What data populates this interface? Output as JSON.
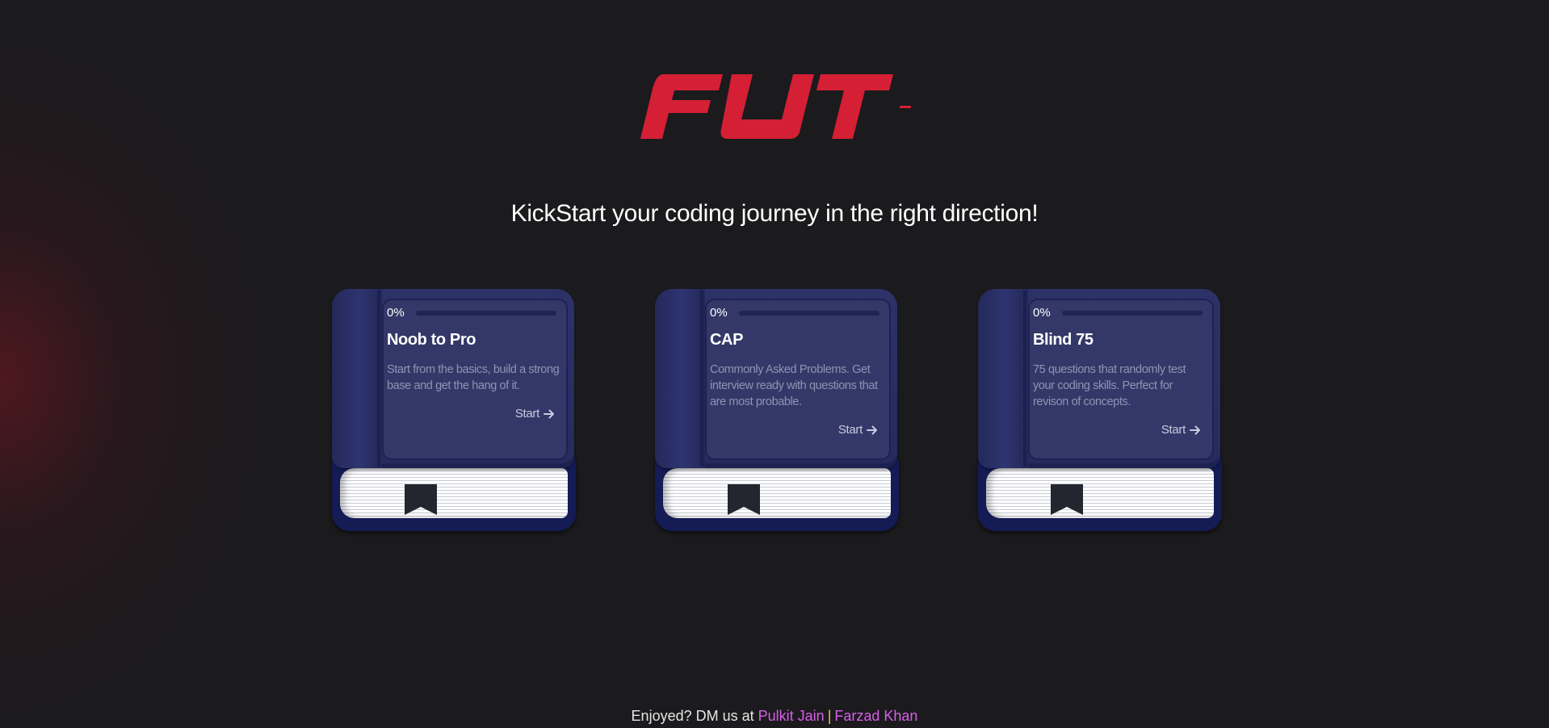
{
  "brand": {
    "logo_text": "FUT-",
    "accent_color": "#d41f35"
  },
  "hero": {
    "tagline": "KickStart your coding journey in the right direction!"
  },
  "books": [
    {
      "progress_label": "0%",
      "progress": 0,
      "title": "Noob to Pro",
      "description": "Start from the basics, build a strong base and get the hang of it.",
      "cta": "Start"
    },
    {
      "progress_label": "0%",
      "progress": 0,
      "title": "CAP",
      "description": "Commonly Asked Problems. Get interview ready with questions that are most probable.",
      "cta": "Start"
    },
    {
      "progress_label": "0%",
      "progress": 0,
      "title": "Blind 75",
      "description": "75 questions that randomly test your coding skills. Perfect for revison of concepts.",
      "cta": "Start"
    }
  ],
  "footer": {
    "prefix": "Enjoyed? DM us at",
    "separator": "|",
    "link_1": "Pulkit Jain",
    "link_2": "Farzad Khan",
    "link_color": "#d65fe8"
  }
}
